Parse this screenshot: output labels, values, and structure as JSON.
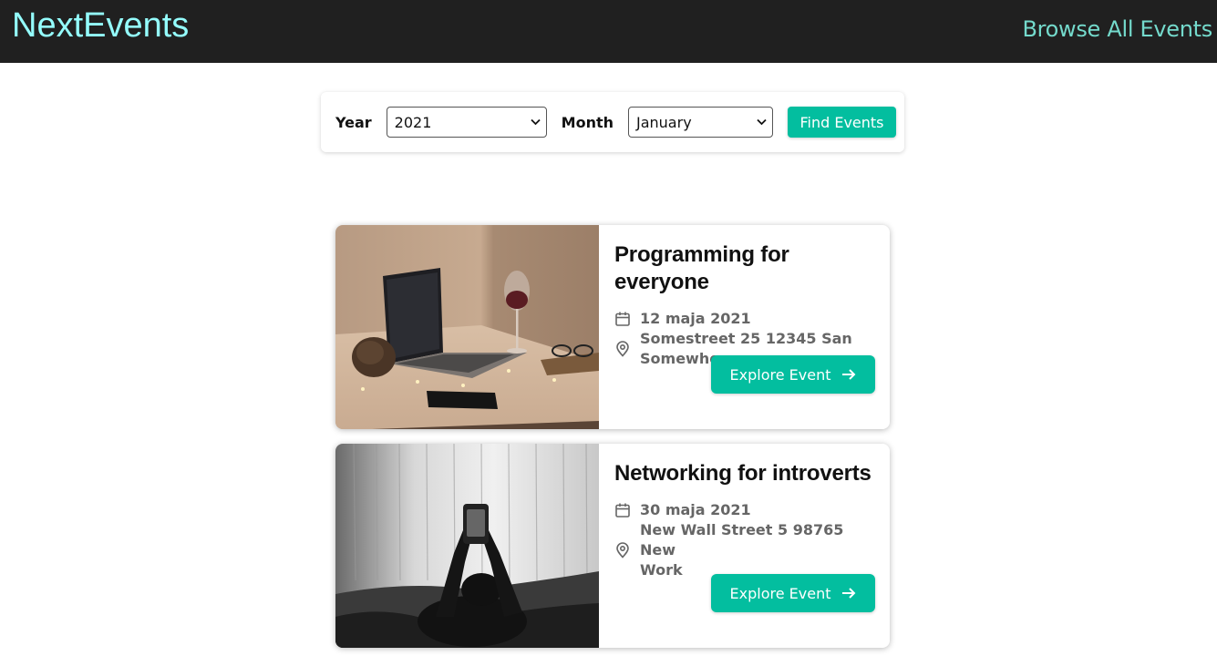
{
  "header": {
    "logo": "NextEvents",
    "nav_link": "Browse All Events"
  },
  "search": {
    "year_label": "Year",
    "year_value": "2021",
    "month_label": "Month",
    "month_value": "January",
    "submit_label": "Find Events"
  },
  "events": [
    {
      "title": "Programming for everyone",
      "date": "12 maja 2021",
      "address_line1": "Somestreet 25 12345 San",
      "address_line2": "Somewhereo",
      "button_label": "Explore Event",
      "image": "laptop-on-desk-photo"
    },
    {
      "title": "Networking for introverts",
      "date": "30 maja 2021",
      "address_line1": "New Wall Street 5 98765 New",
      "address_line2": "Work",
      "button_label": "Explore Event",
      "image": "person-with-phone-photo"
    }
  ],
  "colors": {
    "header_bg": "#202020",
    "logo": "#94fdfd",
    "nav_link": "#74dacc",
    "accent": "#03be9f"
  }
}
